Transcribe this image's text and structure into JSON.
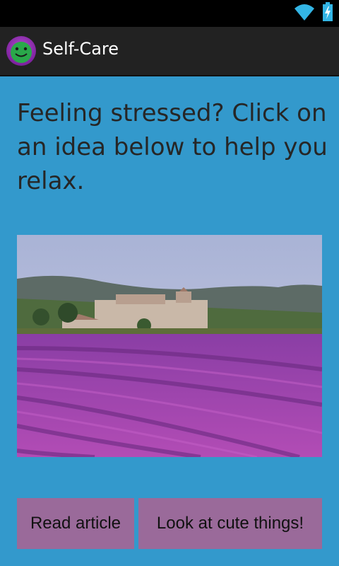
{
  "status_bar": {
    "wifi_icon": "wifi-icon",
    "battery_icon": "battery-charging-icon"
  },
  "action_bar": {
    "app_icon": "smiley-face-icon",
    "title": "Self-Care"
  },
  "main": {
    "prompt": "Feeling stressed? Click on an idea below to help you relax.",
    "image": "lavender-field-photo",
    "buttons": {
      "read_article": "Read article",
      "cute_things": "Look at cute things!"
    }
  },
  "colors": {
    "content_background": "#3399cc",
    "action_bar": "#222222",
    "button_background": "#9a6a9a",
    "status_bar": "#000000"
  }
}
